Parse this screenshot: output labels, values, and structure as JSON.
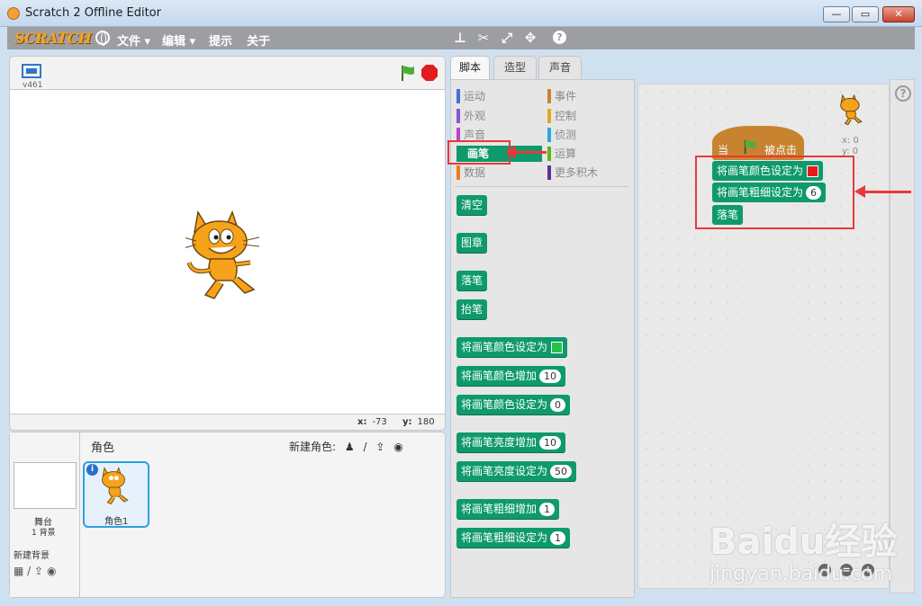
{
  "window": {
    "title": "Scratch 2 Offline Editor"
  },
  "menubar": {
    "logo": "SCRATCH",
    "items": [
      "文件 ▾",
      "编辑 ▾",
      "提示",
      "关于"
    ]
  },
  "stage": {
    "version": "v461",
    "x_label": "x:",
    "x_value": "-73",
    "y_label": "y:",
    "y_value": "180"
  },
  "sprites": {
    "header": "角色",
    "new_sprite_label": "新建角色:",
    "stage_label": "舞台",
    "stage_backdrops": "1 背景",
    "new_backdrop_label": "新建背景",
    "sprite_name": "角色1"
  },
  "tabs": [
    "脚本",
    "造型",
    "声音"
  ],
  "categories": {
    "left": [
      {
        "label": "运动",
        "color": "#4a6cd4"
      },
      {
        "label": "外观",
        "color": "#8a55d7"
      },
      {
        "label": "声音",
        "color": "#bb42c3"
      },
      {
        "label": "画笔",
        "color": "#0e9a6c"
      },
      {
        "label": "数据",
        "color": "#ee7d16"
      }
    ],
    "right": [
      {
        "label": "事件",
        "color": "#c88330"
      },
      {
        "label": "控制",
        "color": "#e1a91a"
      },
      {
        "label": "侦测",
        "color": "#2ca5e2"
      },
      {
        "label": "运算",
        "color": "#5cb712"
      },
      {
        "label": "更多积木",
        "color": "#632d99"
      }
    ]
  },
  "palette_blocks": [
    {
      "label": "清空"
    },
    {
      "label": "图章"
    },
    {
      "label": "落笔"
    },
    {
      "label": "抬笔"
    },
    {
      "label": "将画笔颜色设定为",
      "swatch": "#27c14a"
    },
    {
      "label": "将画笔颜色增加",
      "value": "10"
    },
    {
      "label": "将画笔颜色设定为",
      "value": "0"
    },
    {
      "label": "将画笔亮度增加",
      "value": "10"
    },
    {
      "label": "将画笔亮度设定为",
      "value": "50"
    },
    {
      "label": "将画笔粗细增加",
      "value": "1"
    },
    {
      "label": "将画笔粗细设定为",
      "value": "1"
    }
  ],
  "script": {
    "hat_prefix": "当",
    "hat_suffix": "被点击",
    "blocks": [
      {
        "label": "将画笔颜色设定为",
        "swatch": "#e8191c"
      },
      {
        "label": "将画笔粗细设定为",
        "value": "6"
      },
      {
        "label": "落笔"
      }
    ],
    "sprite_x": "x: 0",
    "sprite_y": "y: 0"
  },
  "watermark": {
    "brand": "Baidu经验",
    "url": "jingyan.baidu.com"
  }
}
